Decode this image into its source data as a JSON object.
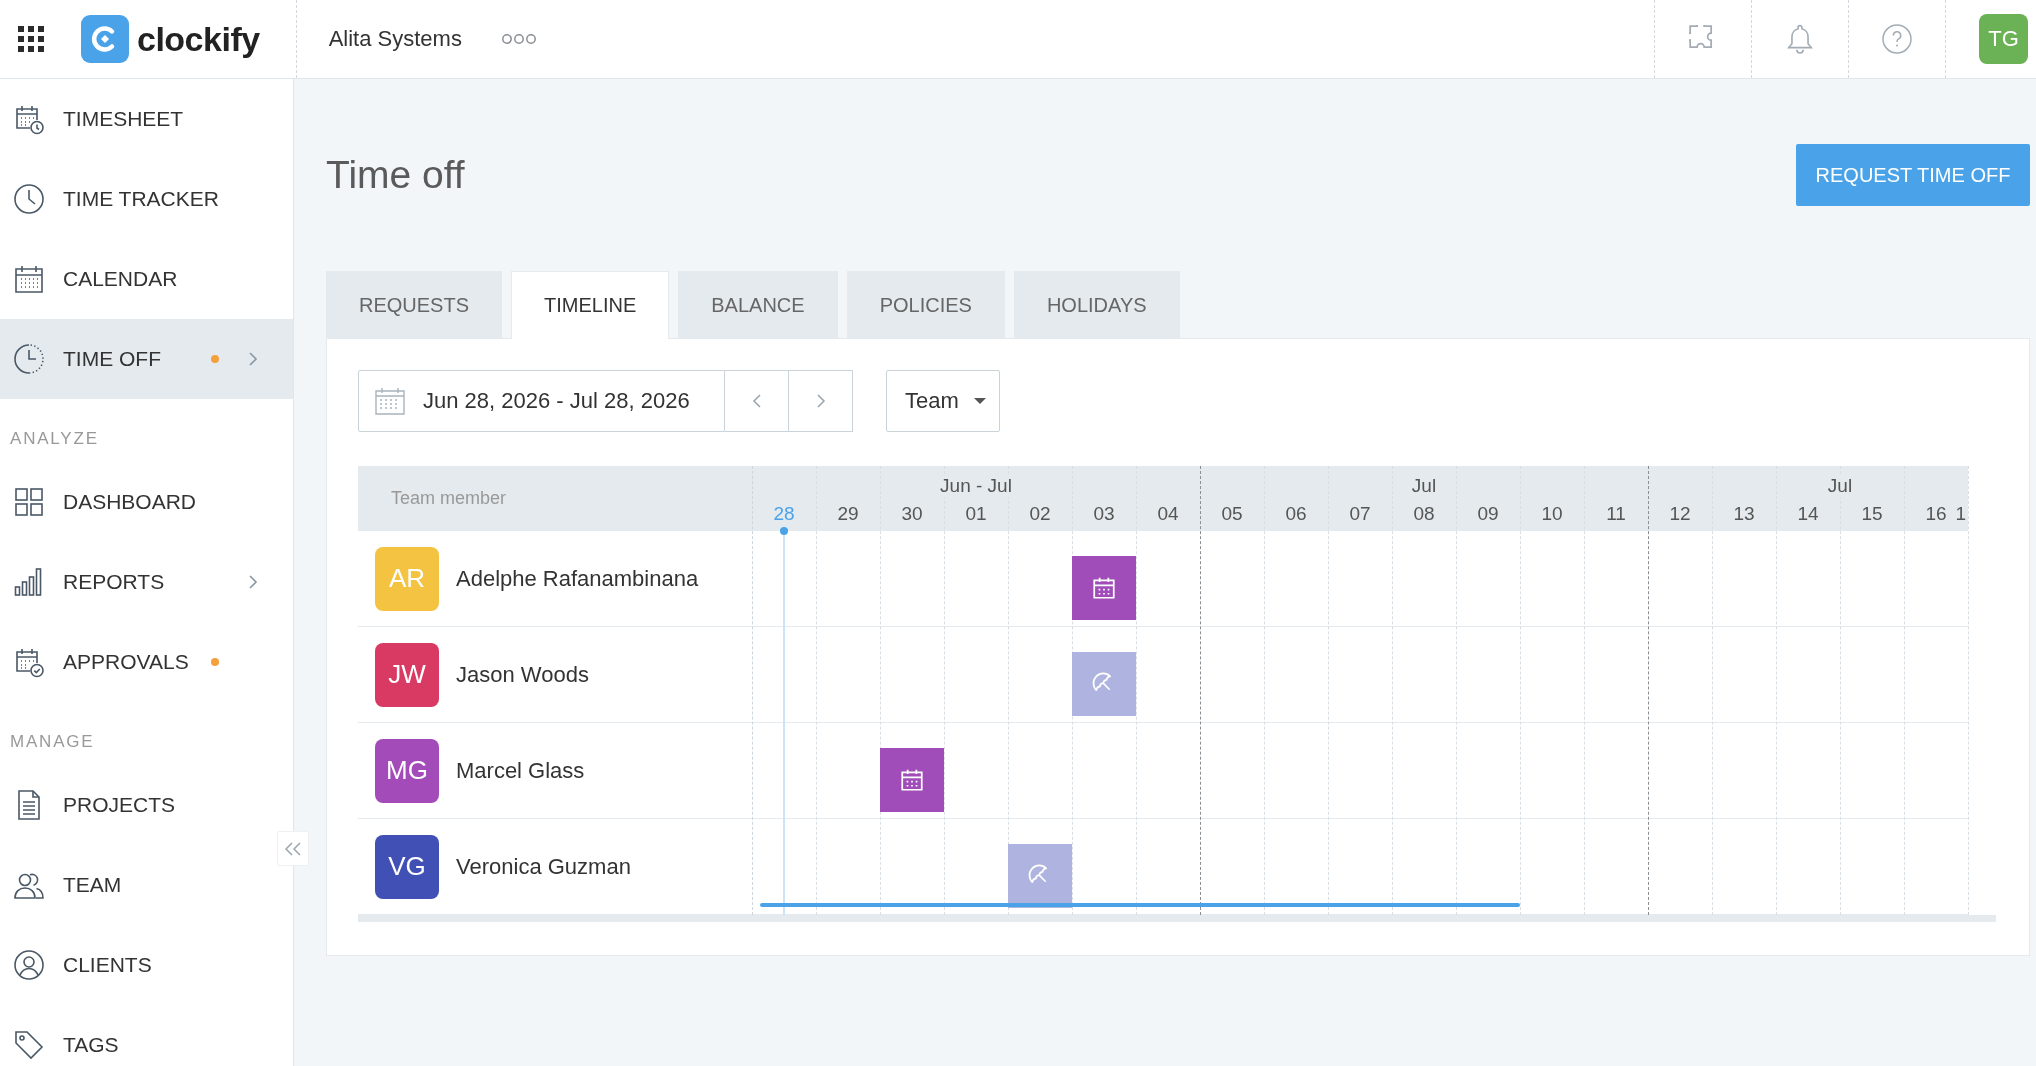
{
  "top_bar": {
    "logo": "clockify",
    "workspace": "Alita Systems",
    "user_initials": "TG"
  },
  "sidebar": {
    "groups": [
      {
        "items": [
          {
            "label": "TIMESHEET",
            "selected": false,
            "alert": false,
            "has_submenu": false
          },
          {
            "label": "TIME TRACKER",
            "selected": false,
            "alert": false,
            "has_submenu": false
          },
          {
            "label": "CALENDAR",
            "selected": false,
            "alert": false,
            "has_submenu": false
          },
          {
            "label": "TIME OFF",
            "selected": true,
            "alert": true,
            "has_submenu": true
          }
        ]
      },
      {
        "heading": "ANALYZE",
        "items": [
          {
            "label": "DASHBOARD",
            "selected": false,
            "alert": false,
            "has_submenu": false
          },
          {
            "label": "REPORTS",
            "selected": false,
            "alert": false,
            "has_submenu": true
          },
          {
            "label": "APPROVALS",
            "selected": false,
            "alert": true,
            "has_submenu": false
          }
        ]
      },
      {
        "heading": "MANAGE",
        "items": [
          {
            "label": "PROJECTS",
            "selected": false,
            "alert": false,
            "has_submenu": false
          },
          {
            "label": "TEAM",
            "selected": false,
            "alert": false,
            "has_submenu": false
          },
          {
            "label": "CLIENTS",
            "selected": false,
            "alert": false,
            "has_submenu": false
          },
          {
            "label": "TAGS",
            "selected": false,
            "alert": false,
            "has_submenu": false
          }
        ]
      }
    ]
  },
  "page": {
    "title": "Time off",
    "primary_button": "REQUEST TIME OFF"
  },
  "tabs": [
    {
      "label": "REQUESTS",
      "selected": false
    },
    {
      "label": "TIMELINE",
      "selected": true
    },
    {
      "label": "BALANCE",
      "selected": false
    },
    {
      "label": "POLICIES",
      "selected": false
    },
    {
      "label": "HOLIDAYS",
      "selected": false
    }
  ],
  "filters": {
    "date_range": "Jun 28, 2026 - Jul 28, 2026",
    "group_by": "Team"
  },
  "timeline": {
    "member_heading": "Team member",
    "months": [
      {
        "label": "Jun - Jul"
      },
      {
        "label": "Jul"
      },
      {
        "label": "Jul"
      }
    ],
    "days": [
      {
        "label": "28",
        "today": true
      },
      {
        "label": "29",
        "today": false
      },
      {
        "label": "30",
        "today": false
      },
      {
        "label": "01",
        "today": false
      },
      {
        "label": "02",
        "today": false
      },
      {
        "label": "03",
        "today": false
      },
      {
        "label": "04",
        "today": false
      },
      {
        "label": "05",
        "today": false
      },
      {
        "label": "06",
        "today": false
      },
      {
        "label": "07",
        "today": false
      },
      {
        "label": "08",
        "today": false
      },
      {
        "label": "09",
        "today": false
      },
      {
        "label": "10",
        "today": false
      },
      {
        "label": "11",
        "today": false
      },
      {
        "label": "12",
        "today": false
      },
      {
        "label": "13",
        "today": false
      },
      {
        "label": "14",
        "today": false
      },
      {
        "label": "15",
        "today": false
      },
      {
        "label": "16",
        "today": false
      },
      {
        "label": "1",
        "today": false
      }
    ],
    "rows": [
      {
        "initials": "AR",
        "name": "Adelphe Rafanambinana",
        "color": "#f5c342",
        "cells": [
          {
            "kind": "empty"
          },
          {
            "kind": "empty"
          },
          {
            "kind": "empty"
          },
          {
            "kind": "empty"
          },
          {
            "kind": "empty"
          },
          {
            "kind": "holiday"
          },
          {
            "kind": "empty"
          },
          {
            "kind": "empty"
          },
          {
            "kind": "empty"
          },
          {
            "kind": "empty"
          },
          {
            "kind": "empty"
          },
          {
            "kind": "empty"
          },
          {
            "kind": "empty"
          },
          {
            "kind": "empty"
          },
          {
            "kind": "empty"
          },
          {
            "kind": "empty"
          },
          {
            "kind": "empty"
          },
          {
            "kind": "empty"
          },
          {
            "kind": "empty"
          },
          {
            "kind": "empty"
          }
        ]
      },
      {
        "initials": "JW",
        "name": "Jason Woods",
        "color": "#d93a63",
        "cells": [
          {
            "kind": "empty"
          },
          {
            "kind": "empty"
          },
          {
            "kind": "empty"
          },
          {
            "kind": "empty"
          },
          {
            "kind": "empty"
          },
          {
            "kind": "time_off"
          },
          {
            "kind": "empty"
          },
          {
            "kind": "empty"
          },
          {
            "kind": "empty"
          },
          {
            "kind": "empty"
          },
          {
            "kind": "empty"
          },
          {
            "kind": "empty"
          },
          {
            "kind": "empty"
          },
          {
            "kind": "empty"
          },
          {
            "kind": "empty"
          },
          {
            "kind": "empty"
          },
          {
            "kind": "empty"
          },
          {
            "kind": "empty"
          },
          {
            "kind": "empty"
          },
          {
            "kind": "empty"
          }
        ]
      },
      {
        "initials": "MG",
        "name": "Marcel Glass",
        "color": "#a34bb9",
        "cells": [
          {
            "kind": "empty"
          },
          {
            "kind": "empty"
          },
          {
            "kind": "holiday"
          },
          {
            "kind": "empty"
          },
          {
            "kind": "empty"
          },
          {
            "kind": "empty"
          },
          {
            "kind": "empty"
          },
          {
            "kind": "empty"
          },
          {
            "kind": "empty"
          },
          {
            "kind": "empty"
          },
          {
            "kind": "empty"
          },
          {
            "kind": "empty"
          },
          {
            "kind": "empty"
          },
          {
            "kind": "empty"
          },
          {
            "kind": "empty"
          },
          {
            "kind": "empty"
          },
          {
            "kind": "empty"
          },
          {
            "kind": "empty"
          },
          {
            "kind": "empty"
          },
          {
            "kind": "empty"
          }
        ]
      },
      {
        "initials": "VG",
        "name": "Veronica Guzman",
        "color": "#4150b5",
        "cells": [
          {
            "kind": "empty"
          },
          {
            "kind": "empty"
          },
          {
            "kind": "empty"
          },
          {
            "kind": "empty"
          },
          {
            "kind": "time_off"
          },
          {
            "kind": "empty"
          },
          {
            "kind": "empty"
          },
          {
            "kind": "empty"
          },
          {
            "kind": "empty"
          },
          {
            "kind": "empty"
          },
          {
            "kind": "empty"
          },
          {
            "kind": "empty"
          },
          {
            "kind": "empty"
          },
          {
            "kind": "empty"
          },
          {
            "kind": "empty"
          },
          {
            "kind": "empty"
          },
          {
            "kind": "empty"
          },
          {
            "kind": "empty"
          },
          {
            "kind": "empty"
          },
          {
            "kind": "empty"
          }
        ]
      }
    ]
  }
}
